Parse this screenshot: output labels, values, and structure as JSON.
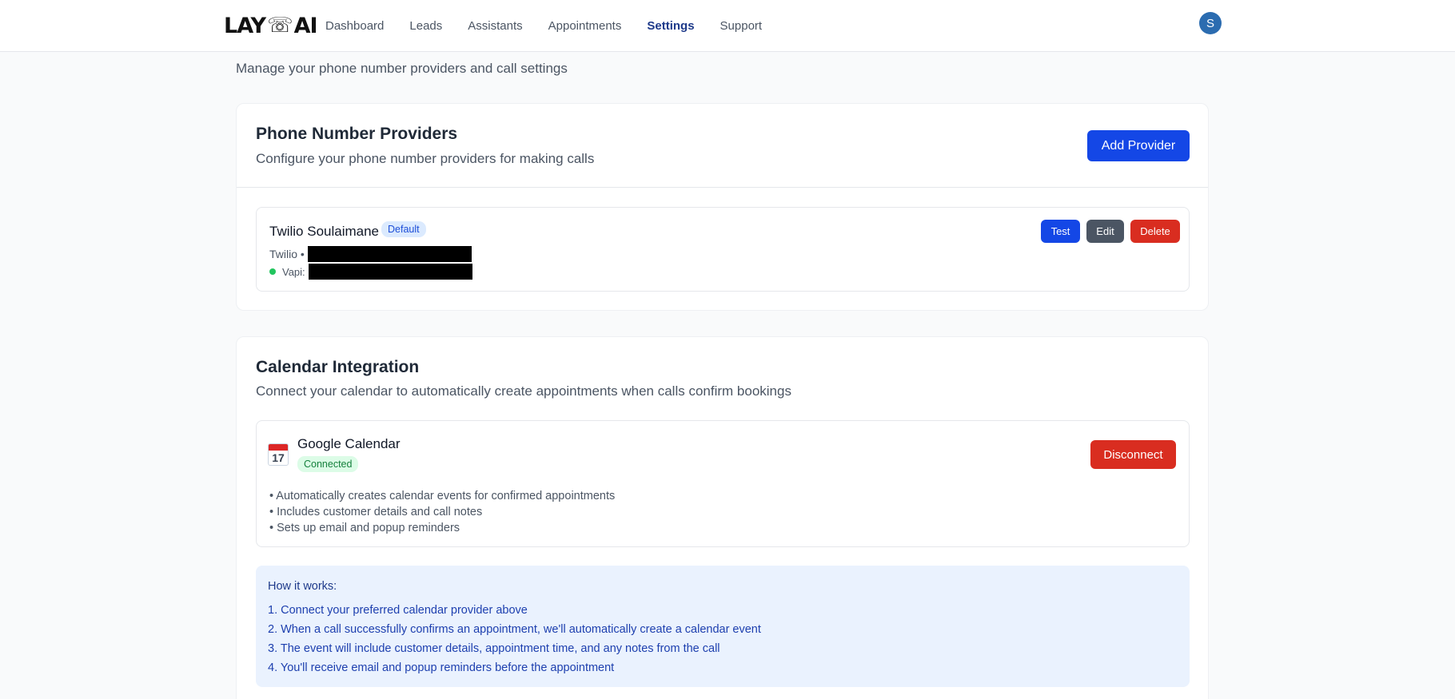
{
  "header": {
    "logo_text_left": "LAY",
    "logo_text_right": "AI",
    "nav": [
      {
        "label": "Dashboard",
        "active": false
      },
      {
        "label": "Leads",
        "active": false
      },
      {
        "label": "Assistants",
        "active": false
      },
      {
        "label": "Appointments",
        "active": false
      },
      {
        "label": "Settings",
        "active": true
      },
      {
        "label": "Support",
        "active": false
      }
    ],
    "avatar_initial": "S"
  },
  "page": {
    "subtitle": "Manage your phone number providers and call settings"
  },
  "providers": {
    "title": "Phone Number Providers",
    "description": "Configure your phone number providers for making calls",
    "add_button": "Add Provider",
    "items": [
      {
        "name": "Twilio Soulaimane",
        "badge": "Default",
        "type_label": "Twilio •",
        "vapi_label": "Vapi:",
        "test_label": "Test",
        "edit_label": "Edit",
        "delete_label": "Delete"
      }
    ]
  },
  "calendar": {
    "title": "Calendar Integration",
    "description": "Connect your calendar to automatically create appointments when calls confirm bookings",
    "provider": {
      "icon_day": "17",
      "name": "Google Calendar",
      "status": "Connected",
      "disconnect_label": "Disconnect",
      "features": [
        "• Automatically creates calendar events for confirmed appointments",
        "• Includes customer details and call notes",
        "• Sets up email and popup reminders"
      ]
    },
    "how": {
      "title": "How it works:",
      "steps": [
        "1. Connect your preferred calendar provider above",
        "2. When a call successfully confirms an appointment, we'll automatically create a calendar event",
        "3. The event will include customer details, appointment time, and any notes from the call",
        "4. You'll receive email and popup reminders before the appointment"
      ]
    }
  },
  "colors": {
    "primary": "#1447e6",
    "danger": "#d92d20",
    "nav_active": "#1e3a8a",
    "info_bg": "#eaf2fe"
  }
}
